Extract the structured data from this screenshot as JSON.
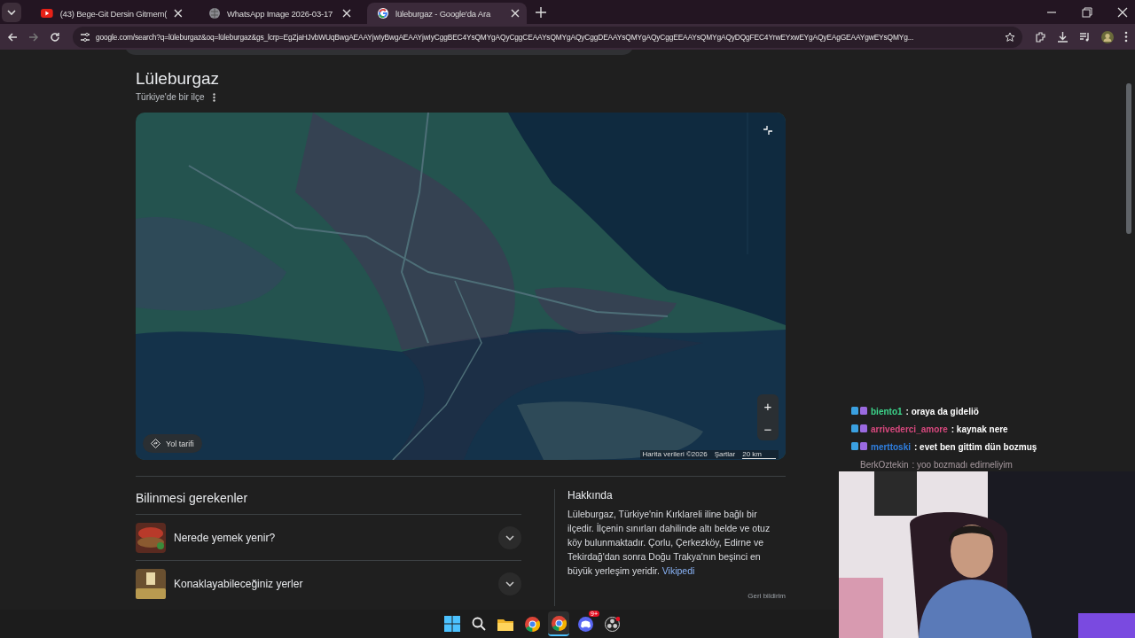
{
  "tabs": [
    {
      "title": "(43) Bege-Git Dersin Gitmem(",
      "kind": "video",
      "selected": false
    },
    {
      "title": "WhatsApp Image 2026-03-17",
      "kind": "globe",
      "selected": false
    },
    {
      "title": "lüleburgaz - Google'da Ara",
      "kind": "google",
      "selected": true
    }
  ],
  "address_bar": {
    "url": "google.com/search?q=lüleburgaz&oq=lüleburgaz&gs_lcrp=EgZjaHJvbWUqBwgAEAAYjwIyBwgAEAAYjwIyCggBEC4YsQMYgAQyCggCEAAYsQMYgAQyCggDEAAYsQMYgAQyCggEEAAYsQMYgAQyDQgFEC4YrwEYxwEYgAQyEAgGEAAYgwEYsQMYg..."
  },
  "result": {
    "title": "Lüleburgaz",
    "subtitle": "Türkiye'de bir ilçe"
  },
  "map": {
    "directions": "Yol tarifi",
    "zoom_in": "+",
    "zoom_out": "−",
    "attribution": "Harita verileri ©2026",
    "terms": "Şartlar",
    "scale": "20 km"
  },
  "things_to_know": {
    "heading": "Bilinmesi gerekenler",
    "items": [
      {
        "label": "Nerede yemek yenir?",
        "kind": "food"
      },
      {
        "label": "Konaklayabileceğiniz yerler",
        "kind": "room"
      }
    ]
  },
  "about": {
    "heading": "Hakkında",
    "text": "Lüleburgaz, Türkiye'nin Kırklareli iline bağlı bir ilçedir. İlçenin sınırları dahilinde altı belde ve otuz köy bulunmaktadır. Çorlu, Çerkezköy, Edirne ve Tekirdağ'dan sonra Doğu Trakya'nın beşinci en büyük yerleşim yeridir.",
    "link": "Vikipedi",
    "feedback": "Geri bildirim"
  },
  "chat": [
    {
      "user": "biento1",
      "message": ": oraya da gideliö",
      "color": "#3dd68c",
      "faded": false
    },
    {
      "user": "arrivederci_amore",
      "message": ": kaynak nere",
      "color": "#d9487e",
      "faded": false
    },
    {
      "user": "merttoski",
      "message": ": evet ben gittim dün bozmuş",
      "color": "#2f7fe0",
      "faded": false
    },
    {
      "user": "BerkOztekin",
      "message": ": yoo bozmadı edirneliyim",
      "color": "#a89aa0",
      "faded": true
    }
  ],
  "taskbar": {
    "apps": [
      {
        "kind": "start",
        "active": false
      },
      {
        "kind": "search",
        "active": false
      },
      {
        "kind": "folder",
        "active": false
      },
      {
        "kind": "chrome",
        "active": false
      },
      {
        "kind": "chrome",
        "active": true
      },
      {
        "kind": "discord",
        "active": false,
        "badge": "9+"
      },
      {
        "kind": "obs",
        "active": false
      }
    ]
  }
}
